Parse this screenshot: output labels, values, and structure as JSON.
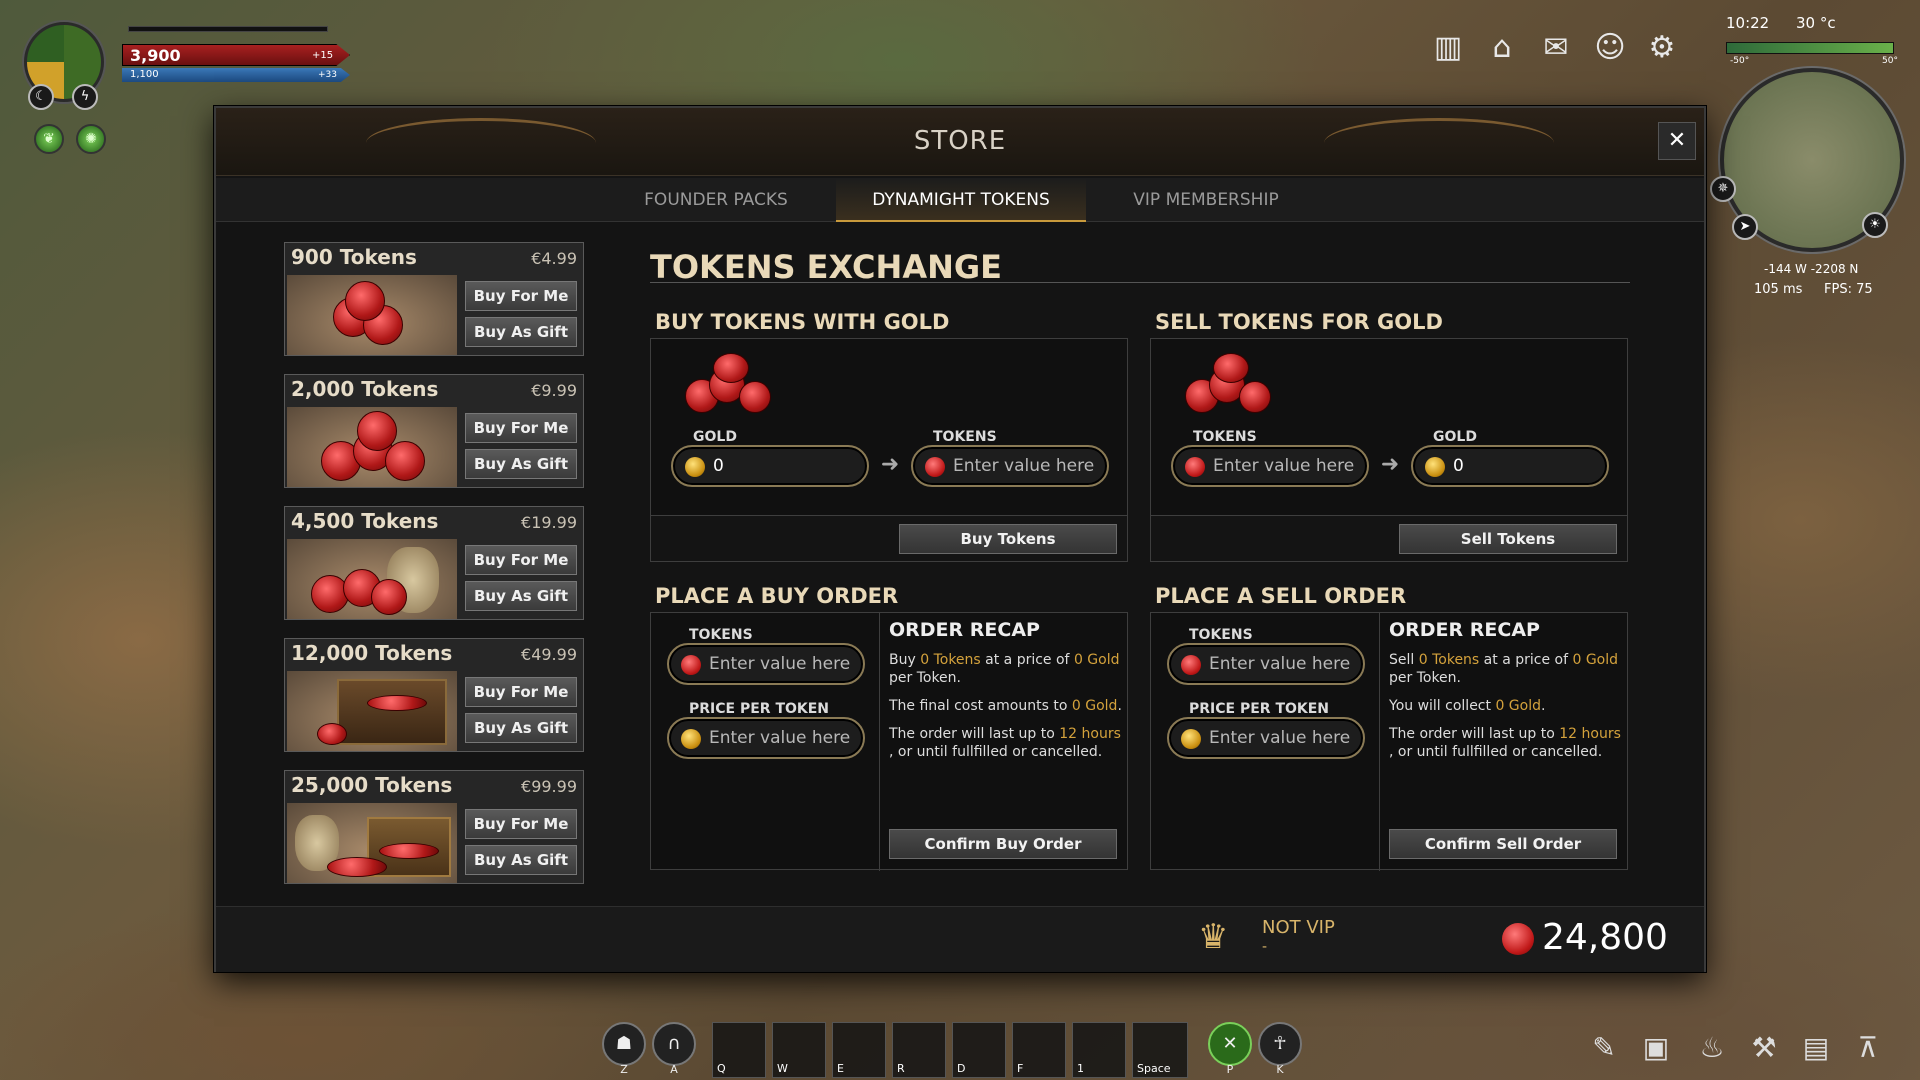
{
  "hud": {
    "hp": "3,900",
    "hp_regen": "+15",
    "mp": "1,100",
    "mp_regen": "+33",
    "clock": "10:22",
    "temperature": "30 °c",
    "temp_low": "-50°",
    "temp_high": "50°",
    "coords": "-144 W -2208 N",
    "ping": "105 ms",
    "fps": "FPS: 75"
  },
  "store": {
    "title": "STORE",
    "tabs": [
      "FOUNDER PACKS",
      "DYNAMIGHT TOKENS",
      "VIP MEMBERSHIP"
    ],
    "active_tab": "DYNAMIGHT TOKENS",
    "packs": [
      {
        "name": "900 Tokens",
        "price": "€4.99",
        "buy_me": "Buy For Me",
        "buy_gift": "Buy As Gift"
      },
      {
        "name": "2,000 Tokens",
        "price": "€9.99",
        "buy_me": "Buy For Me",
        "buy_gift": "Buy As Gift"
      },
      {
        "name": "4,500 Tokens",
        "price": "€19.99",
        "buy_me": "Buy For Me",
        "buy_gift": "Buy As Gift"
      },
      {
        "name": "12,000 Tokens",
        "price": "€49.99",
        "buy_me": "Buy For Me",
        "buy_gift": "Buy As Gift"
      },
      {
        "name": "25,000 Tokens",
        "price": "€99.99",
        "buy_me": "Buy For Me",
        "buy_gift": "Buy As Gift"
      }
    ],
    "exchange": {
      "title": "TOKENS EXCHANGE",
      "buy": {
        "title": "BUY TOKENS WITH GOLD",
        "gold_label": "GOLD",
        "gold_value": "0",
        "tokens_label": "TOKENS",
        "tokens_placeholder": "Enter value here",
        "button": "Buy Tokens"
      },
      "sell": {
        "title": "SELL TOKENS FOR GOLD",
        "tokens_label": "TOKENS",
        "tokens_placeholder": "Enter value here",
        "gold_label": "GOLD",
        "gold_value": "0",
        "button": "Sell Tokens"
      },
      "buy_order": {
        "title": "PLACE A BUY ORDER",
        "tokens_label": "TOKENS",
        "tokens_placeholder": "Enter value here",
        "price_label": "PRICE PER TOKEN",
        "price_placeholder": "Enter value here",
        "recap_title": "ORDER RECAP",
        "recap_a1": "Buy ",
        "recap_a2": "0 Tokens",
        "recap_a3": " at a price of ",
        "recap_a4": "0 Gold",
        "recap_a5": " per Token.",
        "recap_b1": "The final cost amounts to ",
        "recap_b2": "0 Gold",
        "recap_b3": ".",
        "recap_c1": "The order will last up to ",
        "recap_c2": "12 hours",
        "recap_c3": " , or until fullfilled or cancelled.",
        "button": "Confirm Buy Order"
      },
      "sell_order": {
        "title": "PLACE A SELL ORDER",
        "tokens_label": "TOKENS",
        "tokens_placeholder": "Enter value here",
        "price_label": "PRICE PER TOKEN",
        "price_placeholder": "Enter value here",
        "recap_title": "ORDER RECAP",
        "recap_a1": "Sell ",
        "recap_a2": "0 Tokens",
        "recap_a3": " at a price of ",
        "recap_a4": "0 Gold",
        "recap_a5": " per Token.",
        "recap_b1": "You will collect ",
        "recap_b2": "0 Gold",
        "recap_b3": ".",
        "recap_c1": "The order will last up to ",
        "recap_c2": "12 hours",
        "recap_c3": " , or until fullfilled or cancelled.",
        "button": "Confirm Sell Order"
      }
    },
    "footer": {
      "vip_status": "NOT VIP",
      "vip_sub": "-",
      "tokens_balance": "24,800"
    }
  },
  "hotbar": [
    "Q",
    "W",
    "E",
    "R",
    "D",
    "F",
    "1",
    "Space"
  ],
  "skills_left": [
    "Z",
    "A"
  ],
  "skills_right": [
    "P",
    "K"
  ],
  "colors": {
    "accent": "#d4a23c",
    "vip": "#d8b46a",
    "token_red": "#c01818"
  }
}
